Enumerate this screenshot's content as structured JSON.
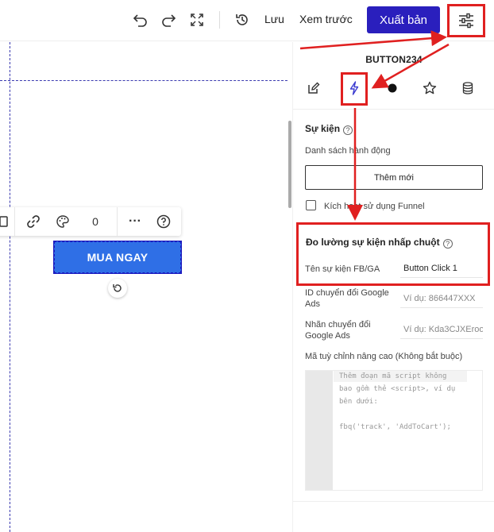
{
  "toolbar": {
    "save_label": "Lưu",
    "preview_label": "Xem trước",
    "export_label": "Xuất bản"
  },
  "canvas": {
    "cta_label": "MUA NGAY",
    "floatbar_count": "0",
    "floatbar_more": "···",
    "floatbar_help": "?"
  },
  "panel": {
    "element_name": "BUTTON234",
    "events": {
      "title": "Sự kiện",
      "help": "?",
      "action_list_label": "Danh sách hành động",
      "add_button": "Thêm mới",
      "funnel_checkbox_label": "Kích hoạt sử dụng Funnel"
    },
    "click_tracking": {
      "title": "Đo lường sự kiện nhấp chuột",
      "help": "?",
      "fb_ga_label": "Tên sự kiện FB/GA",
      "fb_ga_value": "Button Click 1",
      "gads_id_label_1": "ID chuyển đổi Google",
      "gads_id_label_2": "Ads",
      "gads_id_placeholder": "Ví dụ: 866447XXX",
      "gads_label_label_1": "Nhãn chuyển đổi",
      "gads_label_label_2": "Google Ads",
      "gads_label_placeholder": "Ví dụ: Kda3CJXEroo",
      "custom_code_label": "Mã tuỳ chỉnh nâng cao (Không bắt buộc)",
      "code_lines": [
        "Thêm đoạn mã script không",
        "bao gồm thẻ <script>, ví dụ",
        "bên dưới:",
        "",
        "fbq('track', 'AddToCart');"
      ]
    }
  },
  "colors": {
    "accent": "#2a1fbd",
    "cta": "#2f6fe6",
    "annotation": "#e02020"
  },
  "icons": [
    "undo-icon",
    "redo-icon",
    "fullscreen-icon",
    "history-icon",
    "sliders-icon",
    "edit-icon",
    "lightning-icon",
    "circle-icon",
    "star-icon",
    "database-icon",
    "link-icon",
    "palette-icon",
    "rotate-icon"
  ]
}
